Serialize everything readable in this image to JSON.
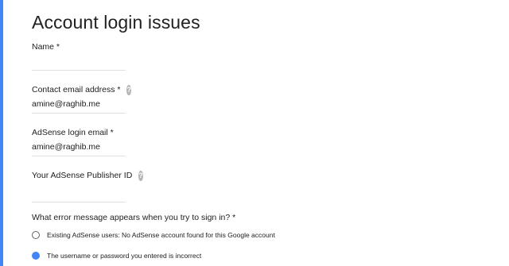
{
  "accent_color": "#4285f4",
  "page": {
    "title": "Account login issues"
  },
  "fields": {
    "name": {
      "label": "Name *",
      "value": ""
    },
    "contact_email": {
      "label": "Contact email address *",
      "value": "amine@raghib.me",
      "help": "?"
    },
    "adsense_email": {
      "label": "AdSense login email *",
      "value": "amine@raghib.me"
    },
    "publisher_id": {
      "label": "Your AdSense Publisher ID",
      "value": "",
      "help": "?"
    }
  },
  "question": {
    "label": "What error message appears when you try to sign in? *",
    "options": [
      {
        "label": "Existing AdSense users: No AdSense account found for this Google account",
        "selected": false
      },
      {
        "label": "The username or password you entered is incorrect",
        "selected": true
      }
    ]
  }
}
